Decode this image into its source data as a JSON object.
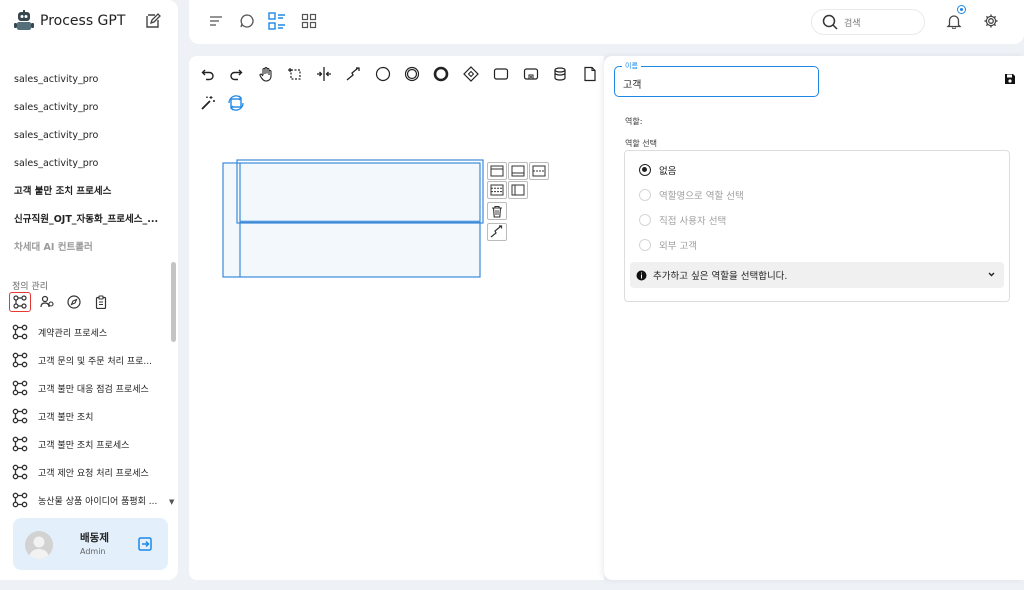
{
  "app": {
    "name": "Process GPT"
  },
  "sidebar": {
    "links": [
      {
        "label": "sales_activity_pro",
        "style": "normal"
      },
      {
        "label": "sales_activity_pro",
        "style": "normal"
      },
      {
        "label": "sales_activity_pro",
        "style": "normal"
      },
      {
        "label": "sales_activity_pro",
        "style": "normal"
      },
      {
        "label": "고객 불만 조치 프로세스",
        "style": "bold"
      },
      {
        "label": "신규직원_OJT_자동화_프로세스_...",
        "style": "bold"
      },
      {
        "label": "차세대 AI 컨트롤러",
        "style": "muted"
      }
    ],
    "section_label": "정의 관리",
    "definition_icons": [
      "process-definition-icon",
      "organization-icon",
      "compass-icon",
      "clipboard-icon"
    ],
    "processes": [
      "계약관리 프로세스",
      "고객 문의 및 주문 처리 프로...",
      "고객 불만 대응 점검 프로세스",
      "고객 불만 조치",
      "고객 불만 조치 프로세스",
      "고객 제안 요청 처리 프로세스",
      "농산물 상품 아이디어 품평회 ..."
    ],
    "user": {
      "name": "배동제",
      "role": "Admin"
    }
  },
  "header": {
    "search_placeholder": "검색",
    "accent": "#1e88e5"
  },
  "toolbar": {
    "row1": [
      "undo-icon",
      "redo-icon",
      "hand-tool-icon",
      "lasso-tool-icon",
      "space-tool-icon",
      "global-connect-icon",
      "start-event-icon",
      "intermediate-event-icon",
      "end-event-icon",
      "gateway-icon",
      "task-icon",
      "subprocess-icon",
      "data-store-icon",
      "data-object-icon"
    ],
    "row2": [
      "magic-wand-icon",
      "lane-swap-icon"
    ]
  },
  "properties": {
    "name_label": "이름",
    "name_value": "고객",
    "role_label": "역할:",
    "role_select_label": "역할 선택",
    "options": [
      {
        "label": "없음",
        "selected": true
      },
      {
        "label": "역할명으로 역할 선택",
        "selected": false
      },
      {
        "label": "직접 사용자 선택",
        "selected": false
      },
      {
        "label": "외부 고객",
        "selected": false
      }
    ],
    "info_text": "추가하고 싶은 역할을 선택합니다."
  }
}
